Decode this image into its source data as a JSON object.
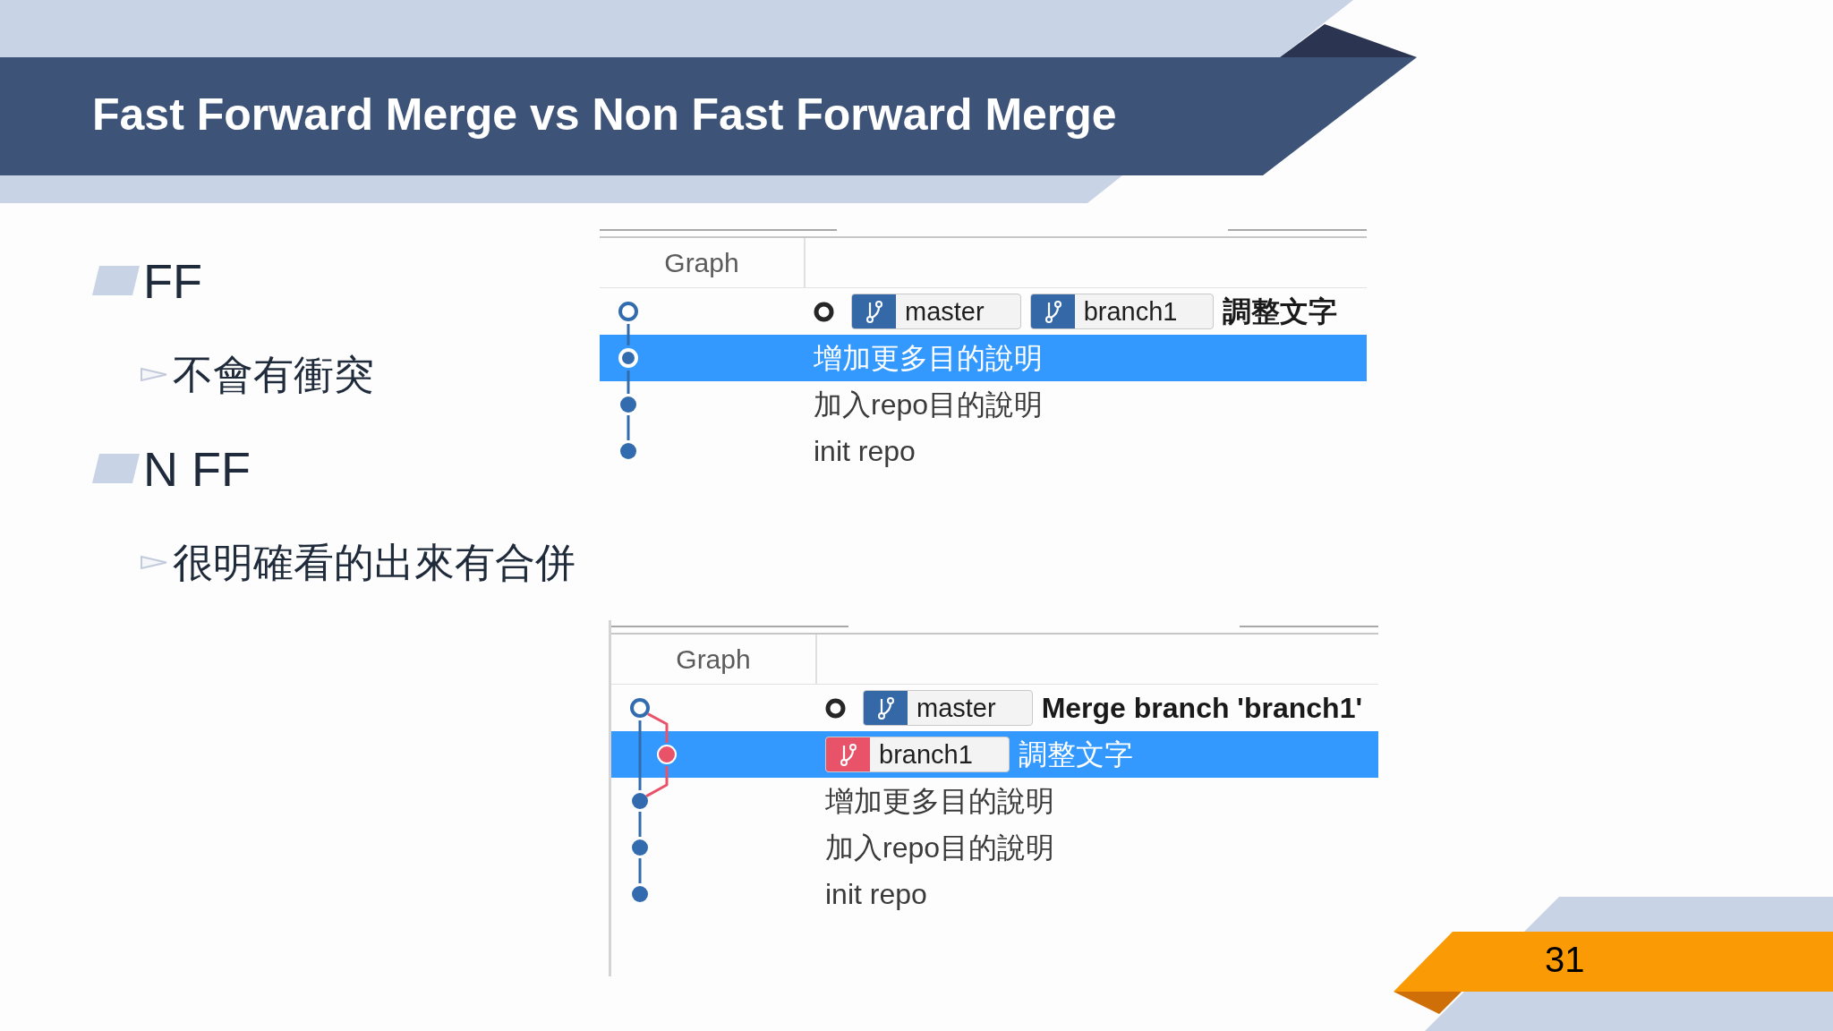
{
  "slide": {
    "title": "Fast Forward Merge vs Non Fast Forward Merge",
    "page_number": "31"
  },
  "bullets": [
    {
      "text": "FF",
      "children": [
        {
          "text": "不會有衝突"
        }
      ]
    },
    {
      "text": "N FF",
      "children": [
        {
          "text": "很明確看的出來有合併"
        }
      ]
    }
  ],
  "screenshots": [
    {
      "columns": [
        "Graph"
      ],
      "rows": [
        {
          "selected": false,
          "head": true,
          "node": {
            "kind": "ring",
            "color": "#336cae"
          },
          "tags": [
            {
              "label": "master",
              "color": "#3568a6"
            },
            {
              "label": "branch1",
              "color": "#3568a6"
            }
          ],
          "message": "調整文字"
        },
        {
          "selected": true,
          "head": false,
          "node": {
            "kind": "ring",
            "color": "#336cae"
          },
          "message": "增加更多目的說明"
        },
        {
          "selected": false,
          "head": false,
          "node": {
            "kind": "dot",
            "color": "#336cae"
          },
          "message": "加入repo目的說明"
        },
        {
          "selected": false,
          "head": false,
          "node": {
            "kind": "dot",
            "color": "#336cae"
          },
          "message": "init repo"
        }
      ]
    },
    {
      "columns": [
        "Graph"
      ],
      "rows": [
        {
          "selected": false,
          "head": true,
          "node": {
            "kind": "ring",
            "color": "#336cae"
          },
          "tags": [
            {
              "label": "master",
              "color": "#3568a6"
            }
          ],
          "message": "Merge branch 'branch1'"
        },
        {
          "selected": true,
          "head": false,
          "node": {
            "kind": "side",
            "color": "#e9536a"
          },
          "tags": [
            {
              "label": "branch1",
              "color": "#e9536a"
            }
          ],
          "message": "調整文字"
        },
        {
          "selected": false,
          "head": false,
          "node": {
            "kind": "dot",
            "color": "#336cae"
          },
          "message": "增加更多目的說明"
        },
        {
          "selected": false,
          "head": false,
          "node": {
            "kind": "dot",
            "color": "#336cae"
          },
          "message": "加入repo目的說明"
        },
        {
          "selected": false,
          "head": false,
          "node": {
            "kind": "dot",
            "color": "#336cae"
          },
          "message": "init repo"
        }
      ]
    }
  ]
}
